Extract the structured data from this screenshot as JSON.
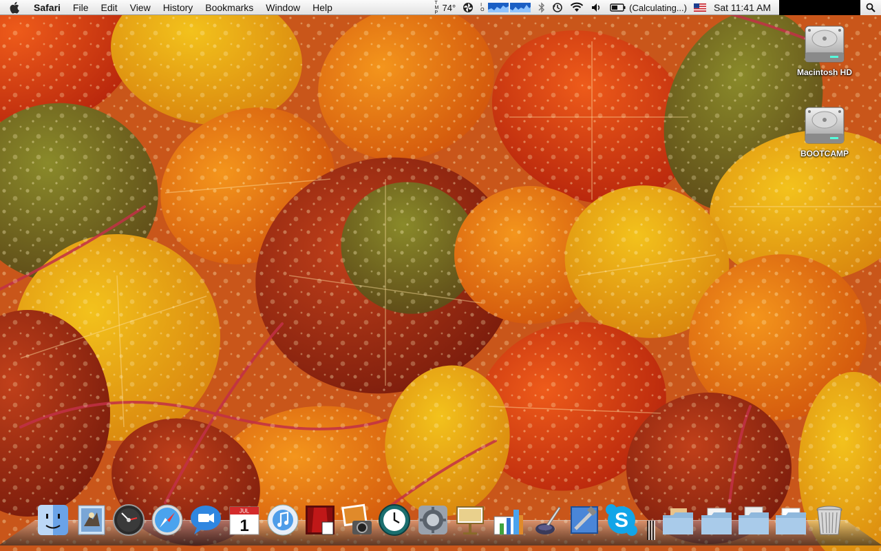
{
  "menubar": {
    "apple_icon": "apple-logo-icon",
    "app_name": "Safari",
    "menus": [
      "File",
      "Edit",
      "View",
      "History",
      "Bookmarks",
      "Window",
      "Help"
    ],
    "status": {
      "temperature": "74°",
      "battery_text": "(Calculating...)",
      "clock": "Sat 11:41 AM"
    }
  },
  "desktop": {
    "icons": [
      {
        "label": "Macintosh HD",
        "icon": "hard-drive-icon"
      },
      {
        "label": "BOOTCAMP",
        "icon": "hard-drive-icon"
      }
    ]
  },
  "dock": {
    "apps": [
      {
        "name": "Finder",
        "icon": "finder-icon"
      },
      {
        "name": "Mail",
        "icon": "mail-icon"
      },
      {
        "name": "Dashboard",
        "icon": "dashboard-icon"
      },
      {
        "name": "Safari",
        "icon": "safari-icon"
      },
      {
        "name": "iChat",
        "icon": "ichat-icon"
      },
      {
        "name": "iCal",
        "icon": "ical-icon",
        "date_text": "1",
        "month_text": "JUL"
      },
      {
        "name": "iTunes",
        "icon": "itunes-icon"
      },
      {
        "name": "Front Row",
        "icon": "front-row-icon"
      },
      {
        "name": "iPhoto",
        "icon": "iphoto-icon"
      },
      {
        "name": "Time Machine",
        "icon": "time-machine-icon"
      },
      {
        "name": "System Preferences",
        "icon": "system-preferences-icon"
      },
      {
        "name": "Keynote",
        "icon": "keynote-icon"
      },
      {
        "name": "Numbers",
        "icon": "numbers-icon"
      },
      {
        "name": "Script Editor",
        "icon": "quill-icon"
      },
      {
        "name": "Xcode",
        "icon": "xcode-icon"
      },
      {
        "name": "Skype",
        "icon": "skype-icon"
      }
    ],
    "stacks": [
      {
        "name": "Applications",
        "icon": "folder-stack-icon"
      },
      {
        "name": "Documents",
        "icon": "folder-stack-icon"
      },
      {
        "name": "Downloads",
        "icon": "folder-stack-icon"
      },
      {
        "name": "Folder",
        "icon": "folder-stack-icon"
      }
    ],
    "trash": {
      "name": "Trash",
      "icon": "trash-icon"
    }
  }
}
